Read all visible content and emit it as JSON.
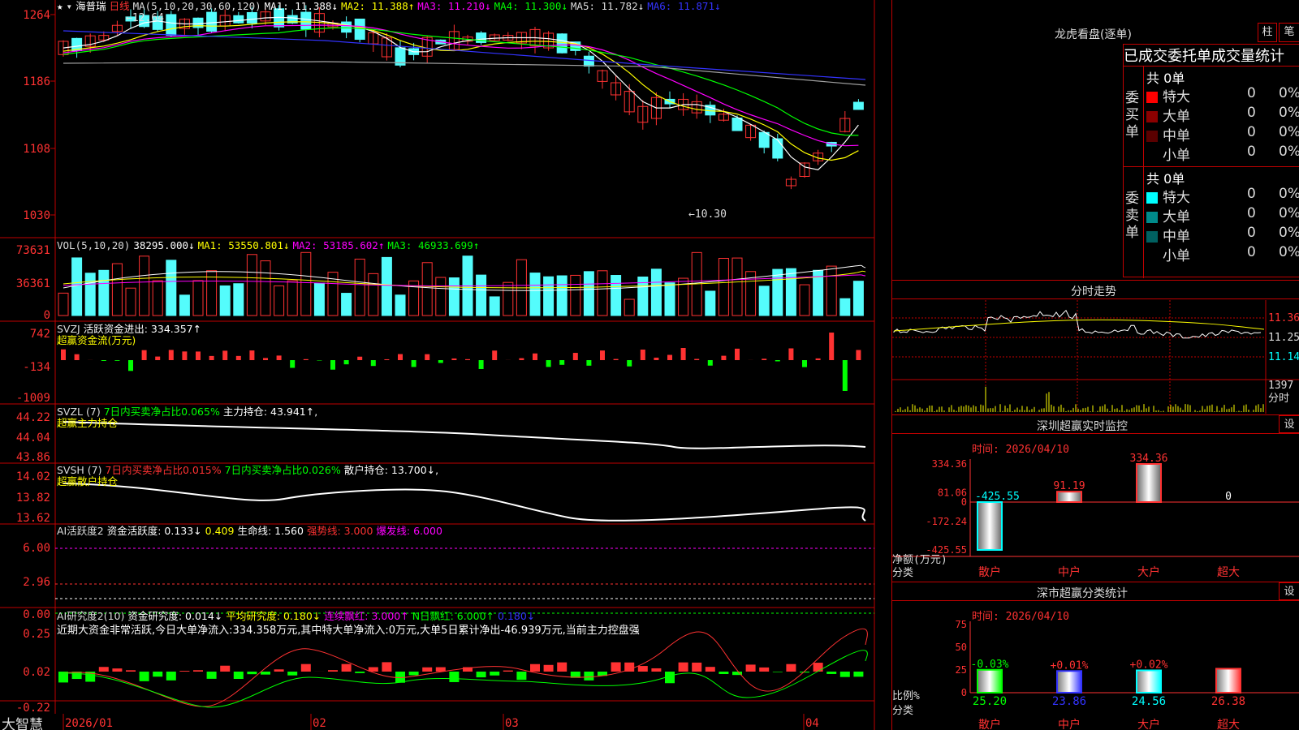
{
  "main_chart": {
    "stock_name": "海普瑞",
    "period": "日线",
    "ma_label": "MA(5,10,20,30,60,120)",
    "ma1": "MA1: 11.388↓",
    "ma2": "MA2: 11.388↑",
    "ma3": "MA3: 11.210↓",
    "ma4": "MA4: 11.300↓",
    "ma5": "MA5: 11.782↓",
    "ma6": "MA6: 11.871↓",
    "ylabels": [
      "1264",
      "1186",
      "1108",
      "1030"
    ],
    "high_mark": "12.64",
    "low_mark": "10.30",
    "colors": {
      "ma1": "#ffffff",
      "ma2": "#ffff00",
      "ma3": "#ff00ff",
      "ma4": "#00ff00",
      "ma5": "#a0a0a0",
      "ma6": "#3333ff",
      "up": "#ff3232",
      "down": "#54fcfc",
      "frame": "#c00000"
    }
  },
  "vol_panel": {
    "label": "VOL(5,10,20)",
    "value": "38295.000↓",
    "ma1": "MA1: 53550.801↓",
    "ma2": "MA2: 53185.602↑",
    "ma3": "MA3: 46933.699↑",
    "ylabels": [
      "73631",
      "36361",
      "0"
    ]
  },
  "svzj_panel": {
    "label": "SVZJ",
    "text": "活跃资金进出: 334.357↑",
    "subtitle": "超赢资金流(万元)",
    "ylabels": [
      "742",
      "-134",
      "-1009"
    ]
  },
  "svzl_panel": {
    "label": "SVZL (7)",
    "text1": "7日内买卖净占比0.065%",
    "text2": "主力持仓: 43.941↑,",
    "subtitle": "超赢主力持仓",
    "ylabels": [
      "44.22",
      "44.04",
      "43.86"
    ]
  },
  "svsh_panel": {
    "label": "SVSH (7)",
    "text1": "7日内买卖净占比0.015%",
    "text2": "7日内买卖净占比0.026%",
    "text3": "散户持仓: 13.700↓,",
    "subtitle": "超赢散户持仓",
    "ylabels": [
      "14.02",
      "13.82",
      "13.62"
    ]
  },
  "ai_active_panel": {
    "label": "AI活跃度2",
    "text1": "资金活跃度: 0.133↓",
    "text2": "0.409",
    "text3": "生命线: 1.560",
    "text4": "强势线: 3.000",
    "text5": "爆发线: 6.000",
    "ylabels": [
      "6.00",
      "2.96",
      "0.00"
    ]
  },
  "ai_research_panel": {
    "label": "AI研究度2(10)",
    "text1": "资金研究度: 0.014↓",
    "text2": "平均研究度: 0.180↓",
    "text3": "连续飘红: 3.000↑",
    "text4": "N日飘红: 6.000↑",
    "text5": "0.180↓",
    "summary": "近期大资金非常活跃,今日大单净流入:334.358万元,其中特大单净流入:0万元,大单5日累计净出-46.939万元,当前主力控盘强",
    "ylabels": [
      "0.25",
      "0.02",
      "-0.22"
    ]
  },
  "date_axis": {
    "brand": "大智慧",
    "labels": [
      "2026/01",
      "02",
      "03",
      "04"
    ]
  },
  "right_panel": {
    "title": "龙虎看盘(逐单)",
    "btn_zhu": "柱",
    "btn_bi": "笔",
    "stats_header": "已成交委托单成交量统计",
    "buy": {
      "side_label": "委买单",
      "total": "共 0单",
      "rows": [
        {
          "name": "特大",
          "count": "0",
          "pct": "0%",
          "color": "#ff0000"
        },
        {
          "name": "大单",
          "count": "0",
          "pct": "0%",
          "color": "#8b0000"
        },
        {
          "name": "中单",
          "count": "0",
          "pct": "0%",
          "color": "#5a0000"
        },
        {
          "name": "小单",
          "count": "0",
          "pct": "0%",
          "color": "#000000"
        }
      ]
    },
    "sell": {
      "side_label": "委卖单",
      "total": "共 0单",
      "rows": [
        {
          "name": "特大",
          "count": "0",
          "pct": "0%",
          "color": "#00ffff"
        },
        {
          "name": "大单",
          "count": "0",
          "pct": "0%",
          "color": "#008b8b"
        },
        {
          "name": "中单",
          "count": "0",
          "pct": "0%",
          "color": "#006060"
        },
        {
          "name": "小单",
          "count": "0",
          "pct": "0%",
          "color": "#000000"
        }
      ]
    },
    "intraday": {
      "title": "分时走势",
      "ylabels": [
        "11.36",
        "11.25",
        "11.14"
      ],
      "vol_label": "1397",
      "vol_unit": "分时"
    },
    "monitor": {
      "title": "深圳超赢实时监控",
      "set_btn": "设",
      "time": "时间: 2026/04/10",
      "ylabels": [
        "334.36",
        "81.06",
        "0",
        "-172.24",
        "-425.55"
      ],
      "ylabel_title": "净额(万元)",
      "xlabel_title": "分类",
      "categories": [
        "散户",
        "中户",
        "大户",
        "超大"
      ],
      "values": [
        -425.55,
        91.19,
        334.36,
        0
      ],
      "value_labels": [
        "-425.55",
        "91.19",
        "334.36",
        "0"
      ]
    },
    "stats": {
      "title": "深市超赢分类统计",
      "set_btn": "设",
      "time": "时间: 2026/04/10",
      "ylabels": [
        "75",
        "50",
        "25",
        "0"
      ],
      "ylabel_title": "比例%",
      "xlabel_title": "分类",
      "categories": [
        "散户",
        "中户",
        "大户",
        "超大"
      ],
      "values": [
        25.2,
        23.86,
        24.56,
        26.38
      ],
      "value_labels": [
        "25.20",
        "23.86",
        "24.56",
        "26.38"
      ],
      "change_labels": [
        "-0.03%",
        "+0.01%",
        "+0.02%",
        ""
      ]
    }
  }
}
